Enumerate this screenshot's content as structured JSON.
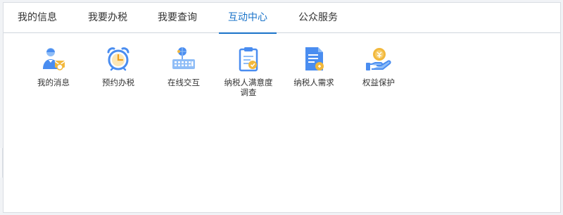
{
  "tabs": [
    {
      "label": "我的信息"
    },
    {
      "label": "我要办税"
    },
    {
      "label": "我要查询"
    },
    {
      "label": "互动中心"
    },
    {
      "label": "公众服务"
    }
  ],
  "active_tab": "互动中心",
  "tiles": [
    {
      "label": "我的消息",
      "icon": "user-message-icon"
    },
    {
      "label": "预约办税",
      "icon": "alarm-clock-icon"
    },
    {
      "label": "在线交互",
      "icon": "keyboard-globe-icon"
    },
    {
      "label": "纳税人满意度\n调查",
      "icon": "clipboard-survey-icon"
    },
    {
      "label": "纳税人需求",
      "icon": "document-request-icon"
    },
    {
      "label": "权益保护",
      "icon": "hand-coin-icon"
    }
  ],
  "colors": {
    "accent": "#1a73c9",
    "icon_blue": "#4a8df0",
    "icon_light_blue": "#8fbdf7",
    "icon_gold": "#f2b83c"
  }
}
